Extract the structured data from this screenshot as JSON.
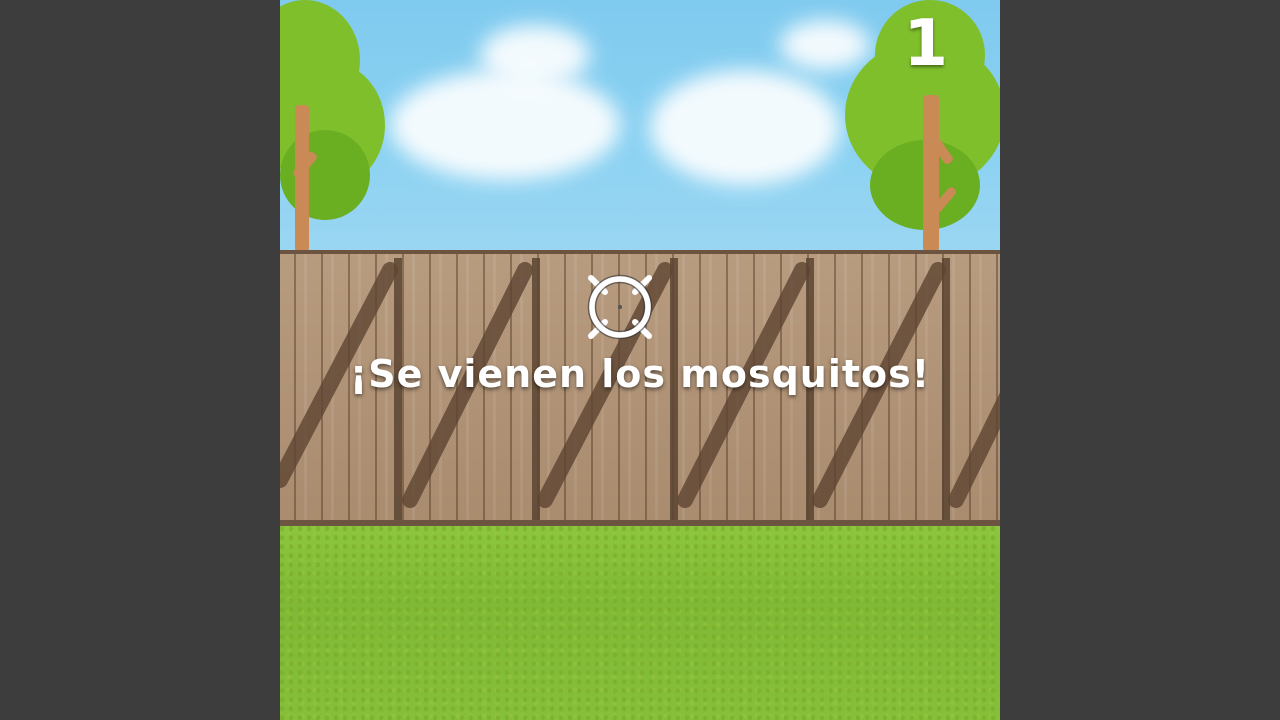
{
  "hud": {
    "score": "1"
  },
  "overlay": {
    "message": "¡Se vienen los mosquitos!"
  },
  "colors": {
    "letterbox": "#3d3d3d",
    "sky": "#8cd2f2",
    "fence": "#a98b6e",
    "grass": "#86bf3a",
    "text": "#ffffff"
  },
  "icons": {
    "crosshair": "crosshair-icon"
  }
}
